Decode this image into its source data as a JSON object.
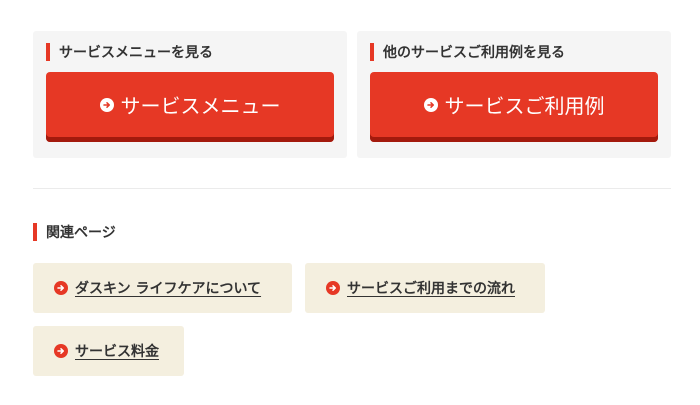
{
  "service_menu_card": {
    "heading": "サービスメニューを見る",
    "button_label": "サービスメニュー"
  },
  "examples_card": {
    "heading": "他のサービスご利用例を見る",
    "button_label": "サービスご利用例"
  },
  "related": {
    "heading": "関連ページ",
    "links": [
      {
        "label": "ダスキン ライフケアについて"
      },
      {
        "label": "サービスご利用までの流れ"
      },
      {
        "label": "サービス料金"
      }
    ]
  },
  "colors": {
    "accent": "#e63825",
    "accent_shadow": "#a31a0d",
    "card_bg": "#f5f5f5",
    "link_bg": "#f4efdf"
  },
  "icons": {
    "button_icon": "arrow-right-circle-icon"
  }
}
